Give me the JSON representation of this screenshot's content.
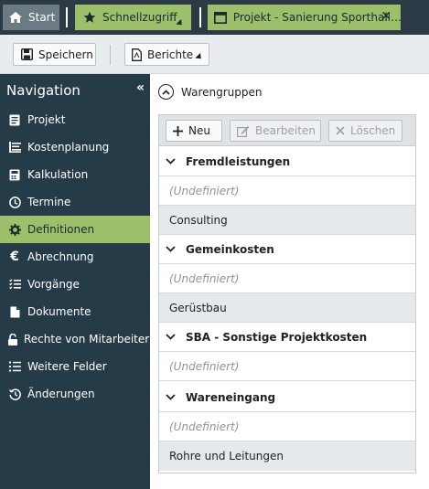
{
  "tabs": {
    "start": "Start",
    "quick": "Schnellzugriff",
    "project": "Projekt - Sanierung Sporthall…"
  },
  "toolbar": {
    "save": "Speichern",
    "reports": "Berichte"
  },
  "sidebar": {
    "title": "Navigation",
    "items": [
      {
        "label": "Projekt",
        "icon": "document-icon"
      },
      {
        "label": "Kostenplanung",
        "icon": "cost-list-icon"
      },
      {
        "label": "Kalkulation",
        "icon": "calculator-icon"
      },
      {
        "label": "Termine",
        "icon": "clock-icon"
      },
      {
        "label": "Definitionen",
        "icon": "gear-icon",
        "active": true
      },
      {
        "label": "Abrechnung",
        "icon": "euro-icon"
      },
      {
        "label": "Vorgänge",
        "icon": "checklist-icon"
      },
      {
        "label": "Dokumente",
        "icon": "file-icon"
      },
      {
        "label": "Rechte von Mitarbeitern",
        "icon": "unlock-icon"
      },
      {
        "label": "Weitere Felder",
        "icon": "list-icon"
      },
      {
        "label": "Änderungen",
        "icon": "history-icon"
      }
    ]
  },
  "main": {
    "section_title": "Warengruppen",
    "grid_toolbar": {
      "new": "Neu",
      "edit": "Bearbeiten",
      "delete": "Löschen"
    },
    "rows": [
      {
        "type": "group",
        "label": "Fremdleistungen"
      },
      {
        "type": "undef",
        "label": "(Undefiniert)"
      },
      {
        "type": "item",
        "label": "Consulting"
      },
      {
        "type": "group",
        "label": "Gemeinkosten"
      },
      {
        "type": "undef",
        "label": "(Undefiniert)"
      },
      {
        "type": "item",
        "label": "Gerüstbau"
      },
      {
        "type": "group",
        "label": "SBA - Sonstige Projektkosten"
      },
      {
        "type": "undef",
        "label": "(Undefiniert)"
      },
      {
        "type": "group",
        "label": "Wareneingang"
      },
      {
        "type": "undef",
        "label": "(Undefiniert)"
      },
      {
        "type": "item",
        "label": "Rohre und Leitungen"
      }
    ]
  },
  "colors": {
    "sidebar_bg": "#253b47",
    "accent_green": "#9cc06a",
    "tabbar_bg": "#2b3a44"
  }
}
